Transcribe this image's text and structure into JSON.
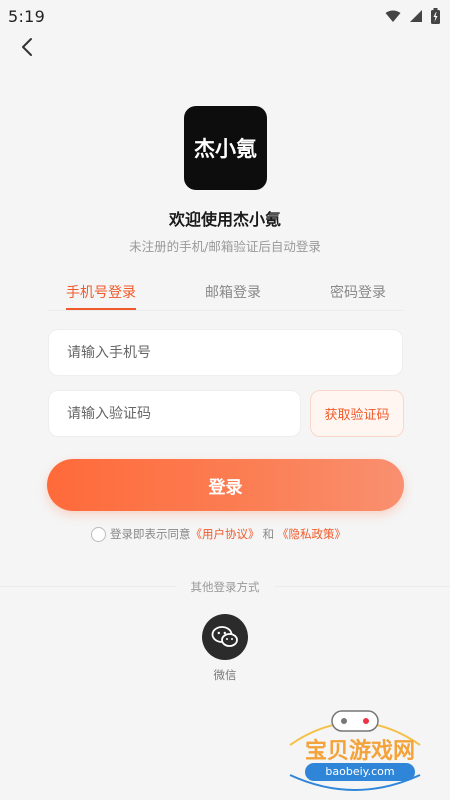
{
  "status_bar": {
    "time": "5:19",
    "icons": [
      "settings-icon",
      "wifi-icon",
      "signal-icon",
      "battery-icon"
    ]
  },
  "header": {
    "back_icon": "chevron-left-icon"
  },
  "logo": {
    "text": "杰小氪"
  },
  "welcome": "欢迎使用杰小氪",
  "subtitle": "未注册的手机/邮箱验证后自动登录",
  "tabs": [
    {
      "label": "手机号登录",
      "active": true
    },
    {
      "label": "邮箱登录",
      "active": false
    },
    {
      "label": "密码登录",
      "active": false
    }
  ],
  "form": {
    "phone_placeholder": "请输入手机号",
    "code_placeholder": "请输入验证码",
    "get_code_label": "获取验证码",
    "login_label": "登录"
  },
  "agreement": {
    "prefix": "登录即表示同意",
    "user_agreement": "《用户协议》",
    "and": "和",
    "privacy_policy": "《隐私政策》"
  },
  "other_login": {
    "title": "其他登录方式",
    "wechat_label": "微信"
  },
  "watermark": {
    "title": "宝贝游戏网",
    "url": "baobeiy.com"
  },
  "colors": {
    "accent": "#f05a2a",
    "button_start": "#ff6a3a",
    "button_end": "#f99070",
    "logo_bg": "#0d0d0d"
  }
}
